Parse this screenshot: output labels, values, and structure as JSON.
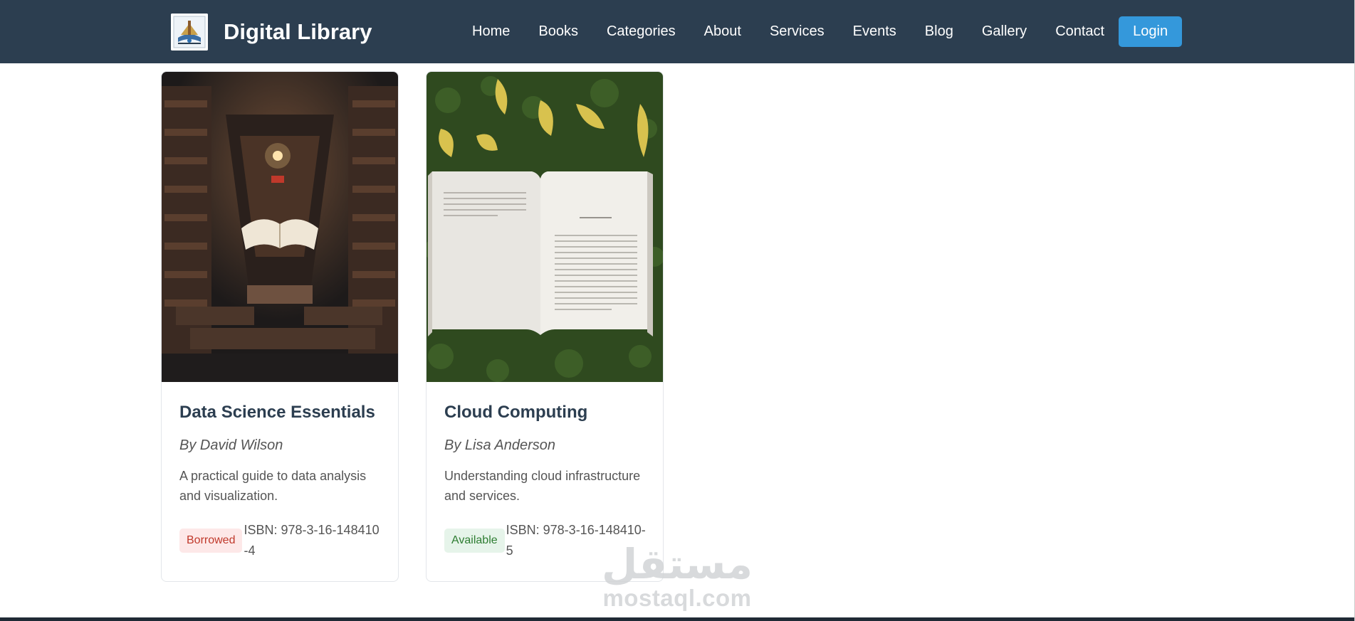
{
  "app": {
    "brand_title": "Digital Library",
    "logo_icon": "library-logo-icon"
  },
  "nav": {
    "items": [
      {
        "label": "Home"
      },
      {
        "label": "Books"
      },
      {
        "label": "Categories"
      },
      {
        "label": "About"
      },
      {
        "label": "Services"
      },
      {
        "label": "Events"
      },
      {
        "label": "Blog"
      },
      {
        "label": "Gallery"
      },
      {
        "label": "Contact"
      }
    ],
    "login_label": "Login"
  },
  "books": [
    {
      "title": "Data Science Essentials",
      "author": "By David Wilson",
      "description": "A practical guide to data analysis and visualization.",
      "status": "Borrowed",
      "isbn": "ISBN: 978-3-16-148410-4",
      "image_icon": "library-book-photo"
    },
    {
      "title": "Cloud Computing",
      "author": "By Lisa Anderson",
      "description": "Understanding cloud infrastructure and services.",
      "status": "Available",
      "isbn": "ISBN: 978-3-16-148410-5",
      "image_icon": "open-book-on-grass-photo"
    }
  ],
  "watermark": {
    "arabic": "مستقل",
    "latin": "mostaql.com"
  },
  "colors": {
    "navbar": "#2c3e50",
    "accent": "#3498db",
    "borrowed_bg": "#fde8e8",
    "borrowed_text": "#c0392b",
    "available_bg": "#e6f4ea",
    "available_text": "#2e7d32"
  }
}
